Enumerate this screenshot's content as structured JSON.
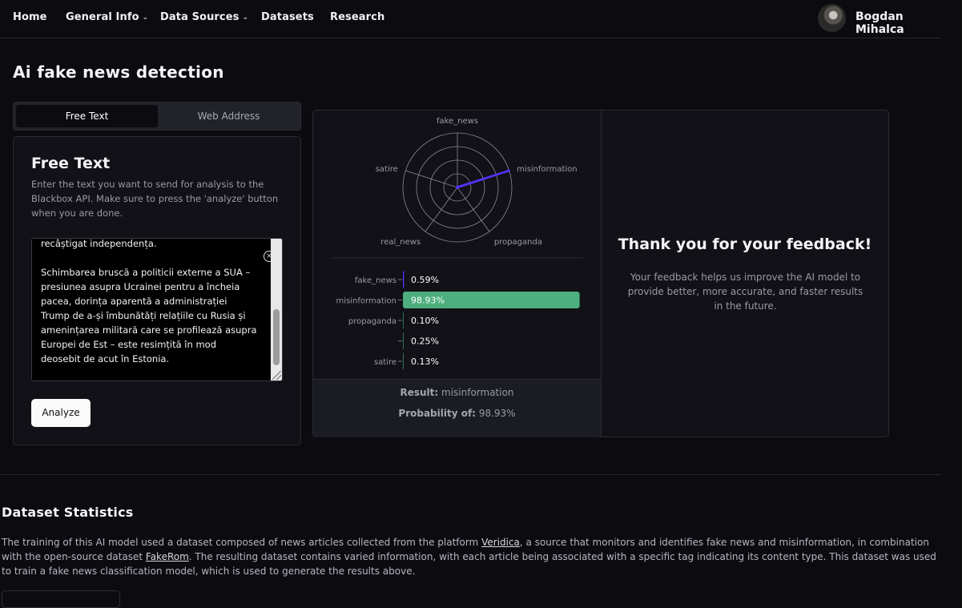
{
  "nav": {
    "items": [
      "Home",
      "General Info",
      "Data Sources",
      "Datasets",
      "Research"
    ],
    "user_name": "Bogdan Mihalca"
  },
  "page": {
    "title": "Ai fake news detection"
  },
  "tabs": [
    "Free Text",
    "Web Address"
  ],
  "free_text": {
    "title": "Free Text",
    "description": "Enter the text you want to send for analysis to the Blackbox API. Make sure to press the 'analyze' button when you are done.",
    "value": "recâștigat independența.\n\nSchimbarea bruscă a politicii externe a SUA – presiunea asupra Ucrainei pentru a încheia pacea, dorința aparentă a administrației Trump de a-și îmbunătăți relațiile cu Rusia și amenințarea militară care se profilează asupra Europei de Est – este resimțită în mod deosebit de acut în Estonia.",
    "analyze_label": "Analyze"
  },
  "chart_data": [
    {
      "type": "radar",
      "axes": [
        "fake_news",
        "misinformation",
        "propaganda",
        "real_news",
        "satire"
      ],
      "values": [
        0.0059,
        0.9893,
        0.001,
        0.0025,
        0.0013
      ],
      "rings": 4,
      "range": [
        0,
        1
      ],
      "color": "#5533ff"
    },
    {
      "type": "bar",
      "orientation": "horizontal",
      "categories": [
        "fake_news",
        "misinformation",
        "propaganda",
        "",
        "satire"
      ],
      "values": [
        0.59,
        98.93,
        0.1,
        0.25,
        0.13
      ],
      "labels": [
        "0.59%",
        "98.93%",
        "0.10%",
        "0.25%",
        "0.13%"
      ],
      "range": [
        0,
        100
      ],
      "colors": [
        "#5533ff",
        "#4caf7d",
        "#4caf7d",
        "#4caf7d",
        "#4caf7d"
      ]
    }
  ],
  "result": {
    "result_label": "Result:",
    "result_value": "misinformation",
    "probability_label": "Probability of:",
    "probability_value": "98.93%"
  },
  "feedback": {
    "title": "Thank you for your feedback!",
    "text": "Your feedback helps us improve the AI model to provide better, more accurate, and faster results in the future."
  },
  "dataset": {
    "title": "Dataset Statistics",
    "text_1": "The training of this AI model used a dataset composed of news articles collected from the platform ",
    "link_1": "Veridica",
    "text_2": ", a source that monitors and identifies fake news and misinformation, in combination with the open-source dataset ",
    "link_2": "FakeRom",
    "text_3": ". The resulting dataset contains varied information, with each article being associated with a specific tag indicating its content type. This dataset was used to train a fake news classification model, which is used to generate the results above."
  }
}
